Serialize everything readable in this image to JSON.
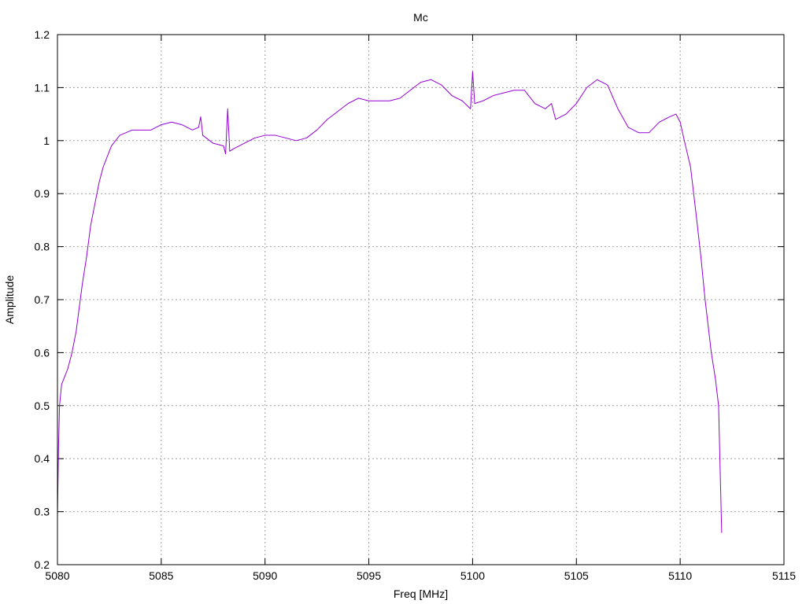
{
  "chart_data": {
    "type": "line",
    "title": "Mc",
    "xlabel": "Freq [MHz]",
    "ylabel": "Amplitude",
    "xlim": [
      5080,
      5115
    ],
    "ylim": [
      0.2,
      1.2
    ],
    "xticks": [
      5080,
      5085,
      5090,
      5095,
      5100,
      5105,
      5110,
      5115
    ],
    "xtick_labels": [
      "5080",
      "5085",
      "5090",
      "5095",
      "5100",
      "5105",
      "5110",
      "5115"
    ],
    "yticks": [
      0.2,
      0.3,
      0.4,
      0.5,
      0.6,
      0.7,
      0.8,
      0.9,
      1.0,
      1.1,
      1.2
    ],
    "ytick_labels": [
      "0.2",
      "0.3",
      "0.4",
      "0.5",
      "0.6",
      "0.7",
      "0.8",
      "0.9",
      "1",
      "1.1",
      "1.2"
    ],
    "grid": true,
    "line_color": "#9400d3",
    "series": [
      {
        "name": "",
        "x": [
          5080.0,
          5080.05,
          5080.1,
          5080.2,
          5080.3,
          5080.5,
          5080.7,
          5080.9,
          5081.0,
          5081.2,
          5081.4,
          5081.6,
          5081.8,
          5082.0,
          5082.2,
          5082.4,
          5082.6,
          5082.8,
          5083.0,
          5083.3,
          5083.6,
          5084.0,
          5084.5,
          5085.0,
          5085.5,
          5086.0,
          5086.5,
          5086.8,
          5086.9,
          5087.0,
          5087.5,
          5088.0,
          5088.1,
          5088.2,
          5088.3,
          5088.5,
          5089.0,
          5089.5,
          5090.0,
          5090.5,
          5091.0,
          5091.5,
          5092.0,
          5092.5,
          5093.0,
          5093.5,
          5094.0,
          5094.5,
          5095.0,
          5095.5,
          5096.0,
          5096.5,
          5097.0,
          5097.5,
          5098.0,
          5098.5,
          5099.0,
          5099.5,
          5099.9,
          5100.0,
          5100.1,
          5100.5,
          5101.0,
          5101.5,
          5102.0,
          5102.5,
          5103.0,
          5103.5,
          5103.8,
          5104.0,
          5104.5,
          5105.0,
          5105.5,
          5106.0,
          5106.5,
          5107.0,
          5107.5,
          5108.0,
          5108.5,
          5109.0,
          5109.5,
          5109.8,
          5110.0,
          5110.2,
          5110.5,
          5110.8,
          5111.0,
          5111.2,
          5111.5,
          5111.7,
          5111.85,
          5112.0
        ],
        "y": [
          0.29,
          0.42,
          0.5,
          0.54,
          0.55,
          0.57,
          0.6,
          0.64,
          0.67,
          0.73,
          0.78,
          0.84,
          0.88,
          0.92,
          0.95,
          0.97,
          0.99,
          1.0,
          1.01,
          1.015,
          1.02,
          1.02,
          1.02,
          1.03,
          1.035,
          1.03,
          1.02,
          1.025,
          1.045,
          1.01,
          0.995,
          0.99,
          0.975,
          1.06,
          0.98,
          0.985,
          0.995,
          1.005,
          1.01,
          1.01,
          1.005,
          1.0,
          1.005,
          1.02,
          1.04,
          1.055,
          1.07,
          1.08,
          1.075,
          1.075,
          1.075,
          1.08,
          1.095,
          1.11,
          1.115,
          1.105,
          1.085,
          1.075,
          1.06,
          1.13,
          1.07,
          1.075,
          1.085,
          1.09,
          1.095,
          1.095,
          1.07,
          1.06,
          1.07,
          1.04,
          1.05,
          1.07,
          1.1,
          1.115,
          1.105,
          1.06,
          1.025,
          1.015,
          1.015,
          1.035,
          1.045,
          1.05,
          1.035,
          1.0,
          0.95,
          0.85,
          0.78,
          0.7,
          0.6,
          0.55,
          0.5,
          0.26
        ]
      }
    ]
  }
}
